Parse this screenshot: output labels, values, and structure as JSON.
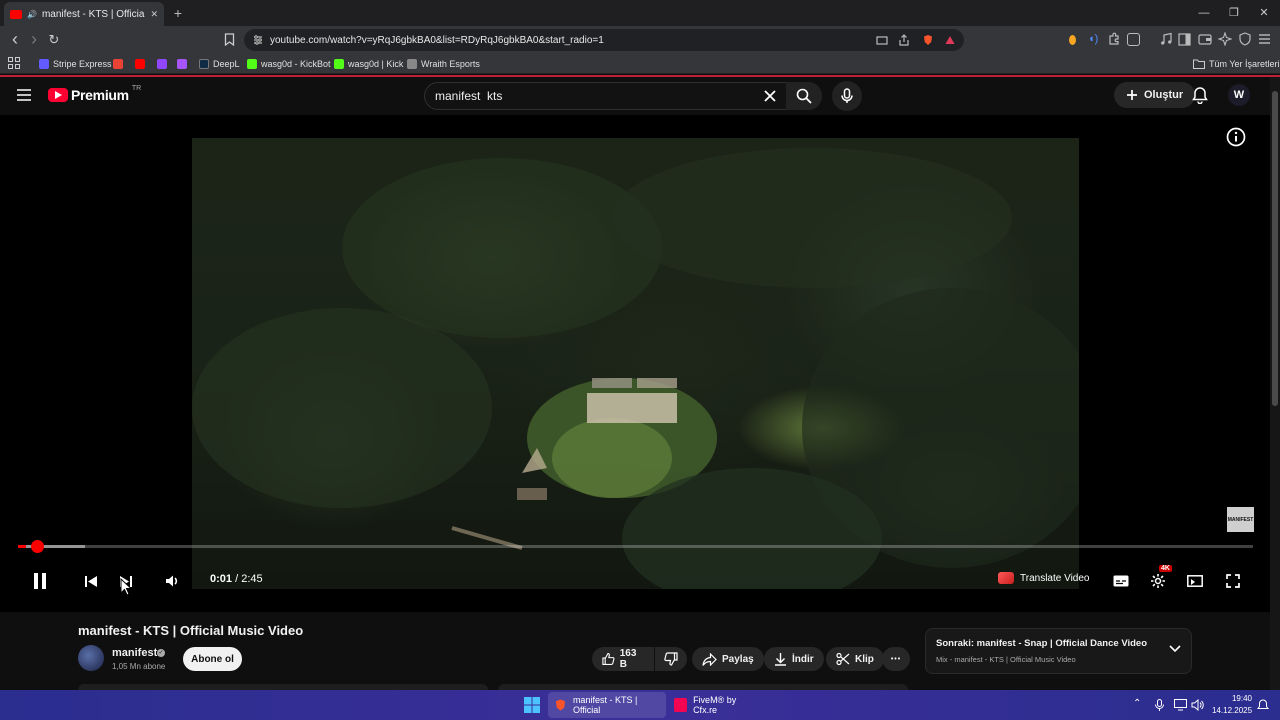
{
  "browser": {
    "tab": {
      "title": "manifest - KTS | Official Music",
      "close_glyph": "✕",
      "favicon": "youtube-favicon"
    },
    "new_tab_glyph": "+",
    "window": {
      "minimize": "—",
      "restore": "❐",
      "close": "✕"
    },
    "url": "youtube.com/watch?v=yRqJ6gbkBA0&list=RDyRqJ6gbkBA0&start_radio=1",
    "nav": {
      "back": "‹",
      "forward": "›",
      "reload": "↻"
    },
    "bookmarks": [
      {
        "label": "Stripe Express",
        "color": "#635bff"
      },
      {
        "label": "",
        "color": "#ea4335"
      },
      {
        "label": "",
        "color": "#ff0000"
      },
      {
        "label": "",
        "color": "#9146ff"
      },
      {
        "label": "",
        "color": "#a855f7"
      },
      {
        "label": "DeepL",
        "color": "#0f2b46"
      },
      {
        "label": "wasg0d - KickBot",
        "color": "#53fc18"
      },
      {
        "label": "wasg0d | Kick",
        "color": "#53fc18"
      },
      {
        "label": "Wraith Esports",
        "color": "#888888"
      }
    ],
    "all_bookmarks": "Tüm Yer İşaretleri"
  },
  "youtube": {
    "logo": {
      "word": "Premium",
      "region": "TR"
    },
    "search": {
      "value": "manifest  kts"
    },
    "create_label": "Oluştur",
    "avatar_letter": "W",
    "accent": "#ff0000"
  },
  "player": {
    "current_time": "0:01",
    "duration": "2:45",
    "time_separator": " / ",
    "progress_fraction": 0.0061,
    "buffer_fraction": 0.054,
    "translate_label": "Translate Video",
    "quality_badge": "4K",
    "watermark": "MANIFEST",
    "state": "playing"
  },
  "video": {
    "title": "manifest - KTS | Official Music Video",
    "channel": "manifest",
    "subscribers": "1,05 Mn abone",
    "subscribe_label": "Abone ol",
    "likes": "163 B",
    "share_label": "Paylaş",
    "download_label": "İndir",
    "clip_label": "Klip",
    "more_glyph": "•••",
    "up_next": {
      "title": "Sonraki: manifest - Snap | Official Dance Video",
      "subtitle": "Mix - manifest - KTS | Official Music Video"
    }
  },
  "taskbar": {
    "apps": [
      {
        "label": "manifest - KTS | Official"
      },
      {
        "label": "FiveM® by Cfx.re"
      }
    ],
    "time": "19:40",
    "date": "14.12.2025"
  }
}
